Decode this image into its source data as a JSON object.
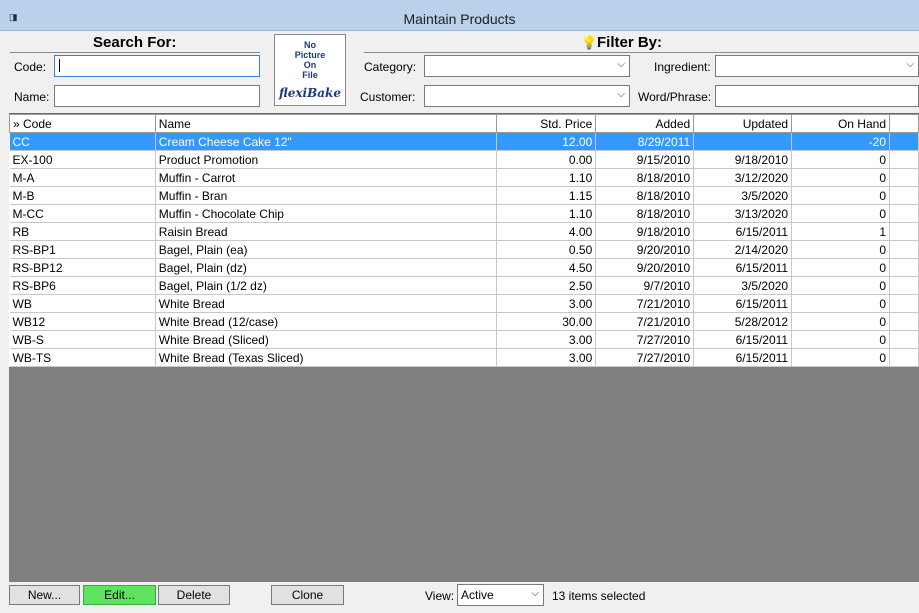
{
  "window": {
    "title": "Maintain Products"
  },
  "search": {
    "heading": "Search For:",
    "code_label": "Code:",
    "code_value": "",
    "name_label": "Name:",
    "name_value": ""
  },
  "picture": {
    "lines": [
      "No",
      "Picture",
      "On",
      "File"
    ],
    "logo": "flexiBake"
  },
  "filter": {
    "heading": "Filter By:",
    "category_label": "Category:",
    "category_value": "",
    "customer_label": "Customer:",
    "customer_value": "",
    "ingredient_label": "Ingredient:",
    "ingredient_value": "",
    "word_label": "Word/Phrase:",
    "word_value": ""
  },
  "table": {
    "columns": [
      "» Code",
      "Name",
      "Std. Price",
      "Added",
      "Updated",
      "On Hand"
    ],
    "rows": [
      [
        "CC",
        "Cream Cheese Cake 12\"",
        "12.00",
        "8/29/2011",
        "",
        "-20"
      ],
      [
        "EX-100",
        "Product Promotion",
        "0.00",
        "9/15/2010",
        "9/18/2010",
        "0"
      ],
      [
        "M-A",
        "Muffin - Carrot",
        "1.10",
        "8/18/2010",
        "3/12/2020",
        "0"
      ],
      [
        "M-B",
        "Muffin - Bran",
        "1.15",
        "8/18/2010",
        "3/5/2020",
        "0"
      ],
      [
        "M-CC",
        "Muffin - Chocolate Chip",
        "1.10",
        "8/18/2010",
        "3/13/2020",
        "0"
      ],
      [
        "RB",
        "Raisin Bread",
        "4.00",
        "9/18/2010",
        "6/15/2011",
        "1"
      ],
      [
        "RS-BP1",
        "Bagel, Plain (ea)",
        "0.50",
        "9/20/2010",
        "2/14/2020",
        "0"
      ],
      [
        "RS-BP12",
        "Bagel, Plain (dz)",
        "4.50",
        "9/20/2010",
        "6/15/2011",
        "0"
      ],
      [
        "RS-BP6",
        "Bagel, Plain (1/2 dz)",
        "2.50",
        "9/7/2010",
        "3/5/2020",
        "0"
      ],
      [
        "WB",
        "White Bread",
        "3.00",
        "7/21/2010",
        "6/15/2011",
        "0"
      ],
      [
        "WB12",
        "White Bread (12/case)",
        "30.00",
        "7/21/2010",
        "5/28/2012",
        "0"
      ],
      [
        "WB-S",
        "White Bread (Sliced)",
        "3.00",
        "7/27/2010",
        "6/15/2011",
        "0"
      ],
      [
        "WB-TS",
        "White Bread (Texas Sliced)",
        "3.00",
        "7/27/2010",
        "6/15/2011",
        "0"
      ]
    ]
  },
  "footer": {
    "new_label": "New...",
    "edit_label": "Edit...",
    "delete_label": "Delete",
    "clone_label": "Clone",
    "view_label": "View:",
    "view_value": "Active",
    "status_text": "13 items selected"
  },
  "colors": {
    "selected_row": "#3399ff",
    "edit_button": "#5ee35e",
    "titlebar": "#b9d1ea",
    "grid_empty": "#808080"
  }
}
